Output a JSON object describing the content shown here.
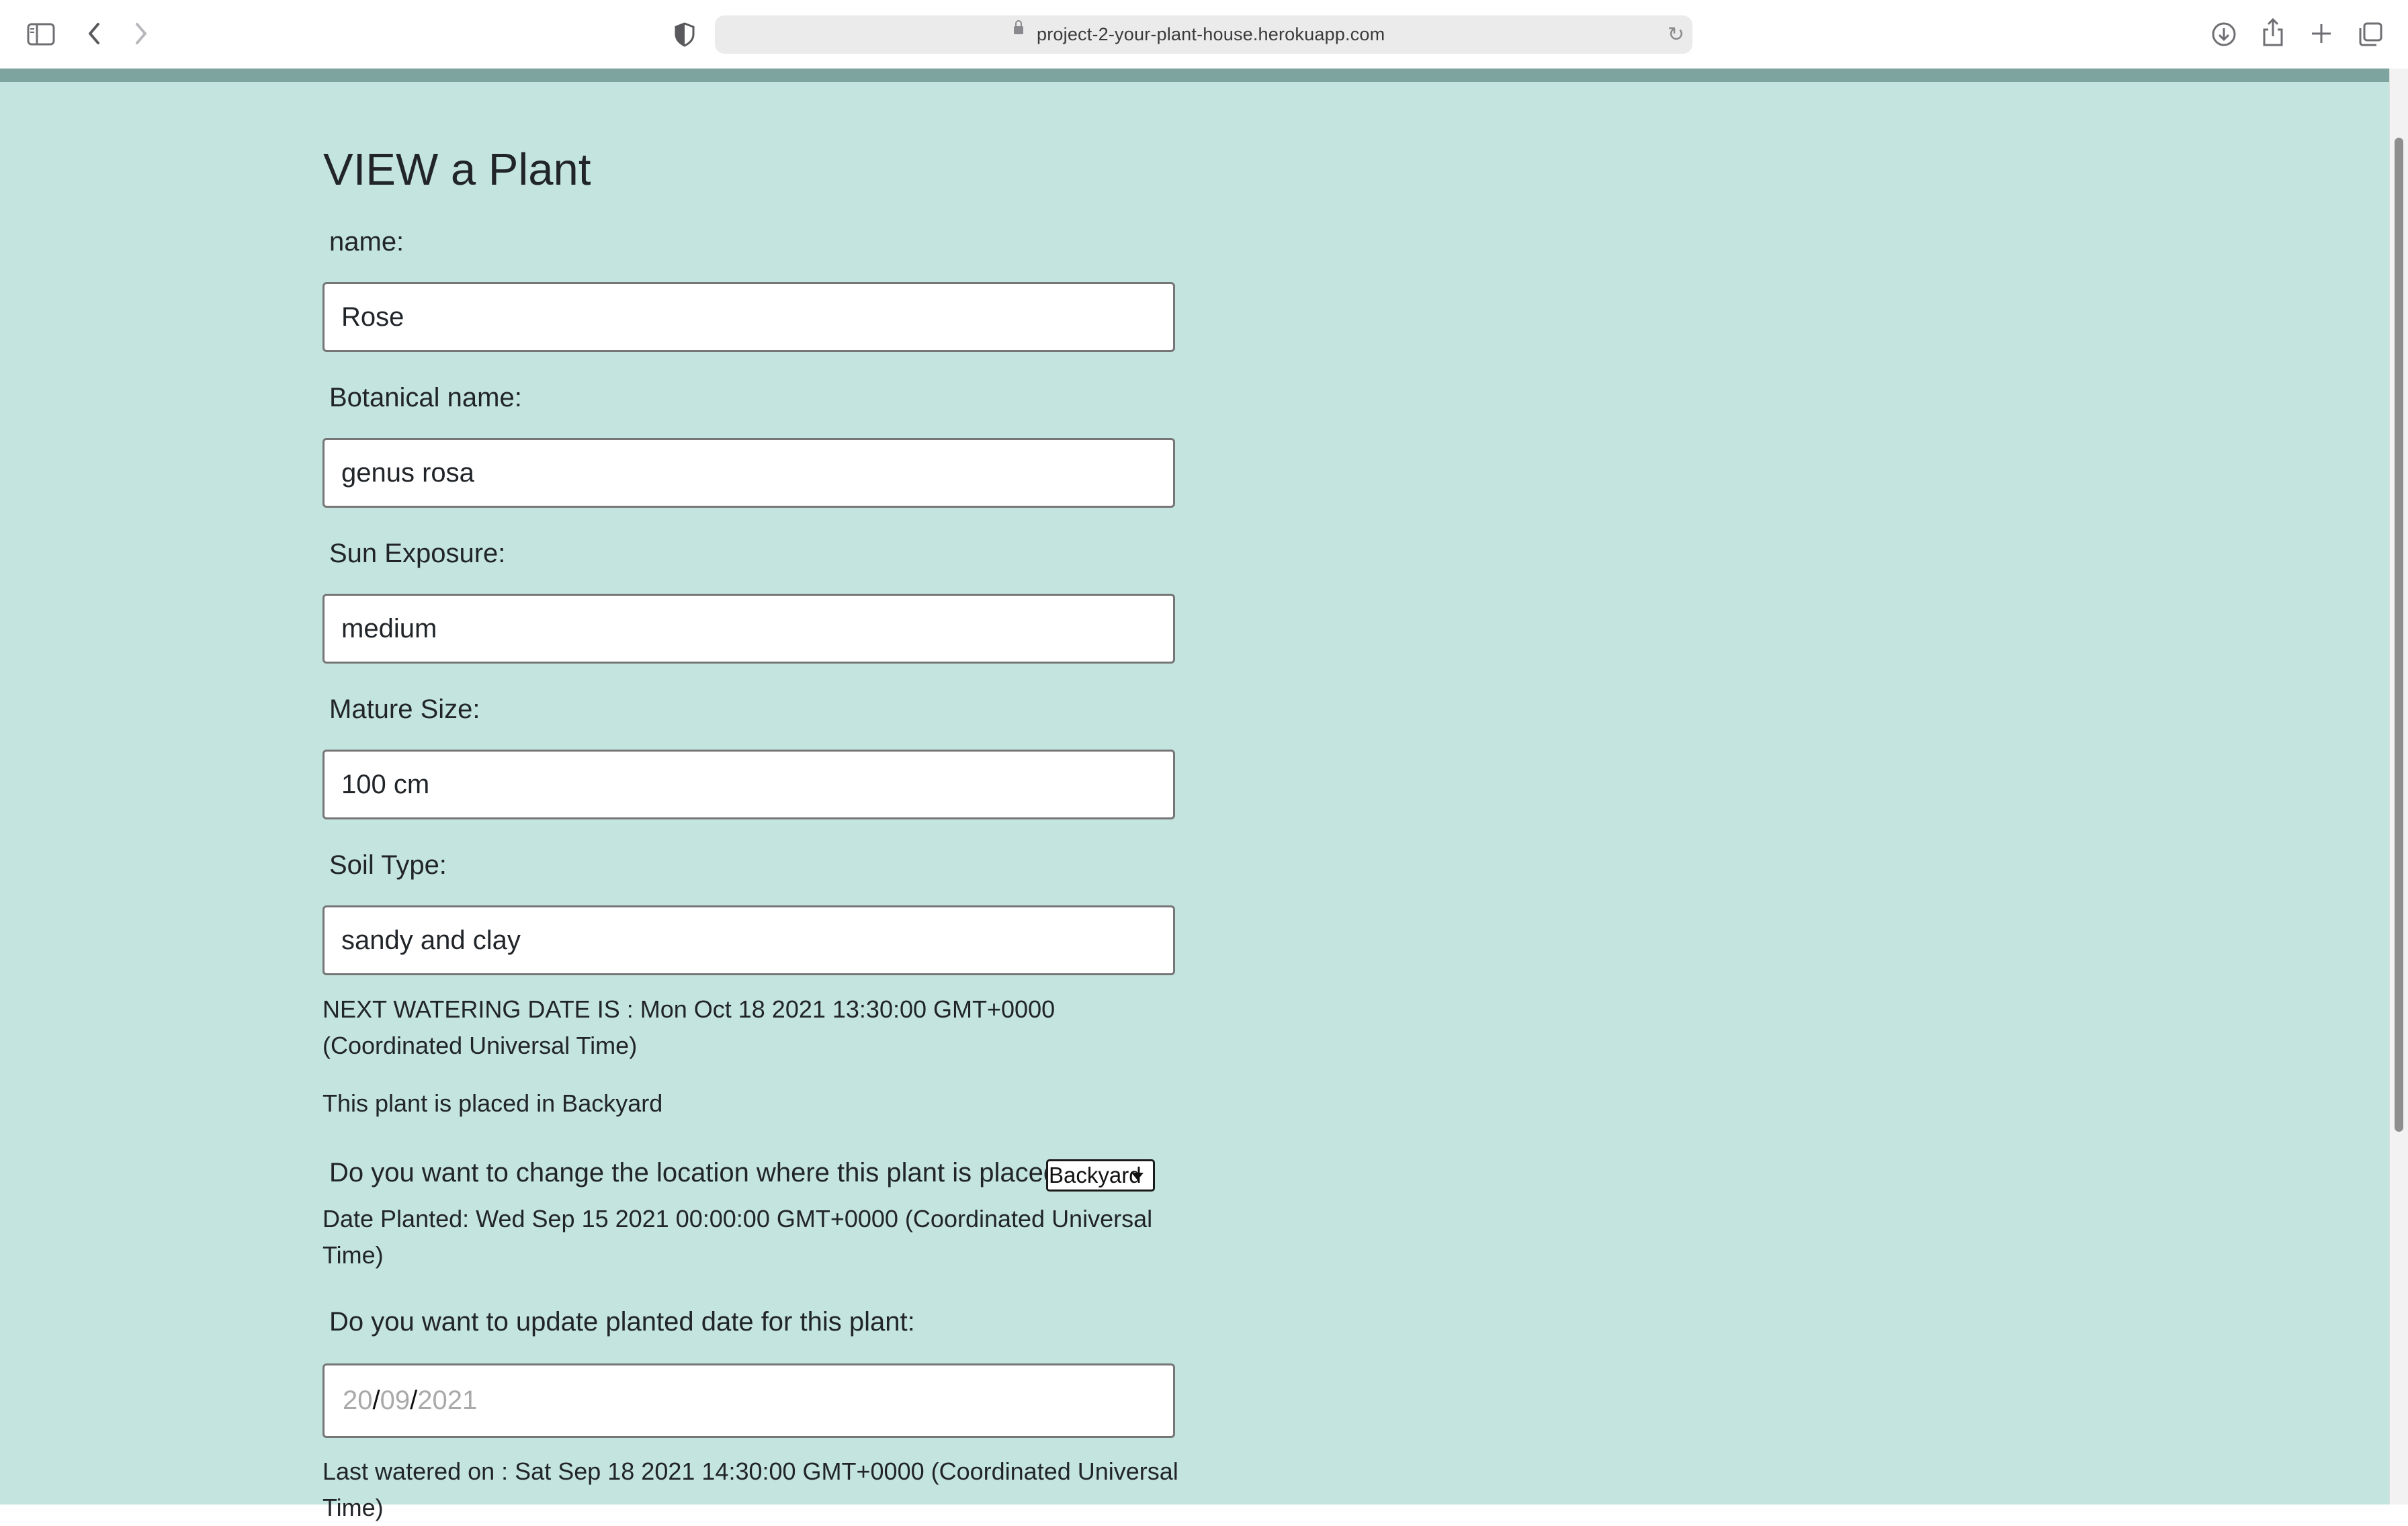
{
  "browser": {
    "url": "project-2-your-plant-house.herokuapp.com",
    "icons": [
      "sidebar-icon",
      "back-icon",
      "forward-icon",
      "privacy-shield-icon",
      "lock-icon",
      "reload-icon",
      "download-icon",
      "share-icon",
      "new-tab-icon",
      "tab-overview-icon"
    ]
  },
  "page": {
    "title": "VIEW a Plant",
    "fields": {
      "name_label": "name:",
      "name_value": "Rose",
      "botanical_label": "Botanical name:",
      "botanical_value": "genus rosa",
      "sun_label": "Sun Exposure:",
      "sun_value": "medium",
      "size_label": "Mature Size:",
      "size_value": "100 cm",
      "soil_label": "Soil Type:",
      "soil_value": "sandy and clay"
    },
    "next_watering": "NEXT WATERING DATE IS : Mon Oct 18 2021 13:30:00 GMT+0000 (Coordinated Universal Time)",
    "placed_in": "This plant is placed in Backyard",
    "change_location_label": "Do you want to change the location where this plant is placed?",
    "location_selected": "Backyard",
    "date_planted": "Date Planted: Wed Sep 15 2021 00:00:00 GMT+0000 (Coordinated Universal Time)",
    "update_planted_label": "Do you want to update planted date for this plant:",
    "date_input": {
      "day": "20",
      "month": "09",
      "year": "2021",
      "separator": "/"
    },
    "last_watered": "Last watered on : Sat Sep 18 2021 14:30:00 GMT+0000 (Coordinated Universal Time)"
  },
  "colors": {
    "page_background": "#c4e4df",
    "nav_band": "#7ea49f",
    "text": "#212529"
  }
}
